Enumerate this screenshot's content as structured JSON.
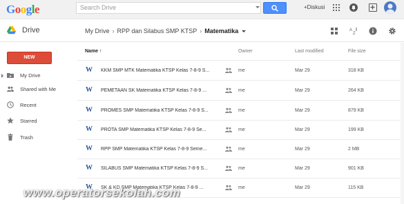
{
  "topbar": {
    "logo": [
      "G",
      "o",
      "o",
      "g",
      "l",
      "e"
    ],
    "logo_colors": [
      "#4285f4",
      "#ea4335",
      "#fbbc05",
      "#4285f4",
      "#34a853",
      "#ea4335"
    ],
    "search_placeholder": "Search Drive",
    "diskusi_label": "+Diskusi"
  },
  "drive": {
    "title": "Drive",
    "breadcrumb": [
      "My Drive",
      "RPP dan Silabus SMP KTSP",
      "Matematika"
    ]
  },
  "sidebar": {
    "new_label": "NEW",
    "items": [
      {
        "label": "My Drive",
        "icon": "folder-icon"
      },
      {
        "label": "Shared with Me",
        "icon": "people-icon"
      },
      {
        "label": "Recent",
        "icon": "clock-icon"
      },
      {
        "label": "Starred",
        "icon": "star-icon"
      },
      {
        "label": "Trash",
        "icon": "trash-icon"
      }
    ]
  },
  "list": {
    "headers": {
      "name": "Name ↑",
      "owner": "Owner",
      "modified": "Last modified",
      "size": "File size"
    },
    "files": [
      {
        "icon": "W",
        "name": "KKM SMP MTK Matematika KTSP Kelas 7-8-9 S...",
        "owner": "me",
        "modified": "Mar 29",
        "size": "318 KB"
      },
      {
        "icon": "W",
        "name": "PEMETAAN SK Matematika KTSP Kelas 7-8-9 ...",
        "owner": "me",
        "modified": "Mar 29",
        "size": "264 KB"
      },
      {
        "icon": "W",
        "name": "PROMES SMP Matematika KTSP Kelas 7-8-9 S...",
        "owner": "me",
        "modified": "Mar 29",
        "size": "879 KB"
      },
      {
        "icon": "W",
        "name": "PROTA SMP Matematika KTSP Kelas 7-8-9 Se...",
        "owner": "me",
        "modified": "Mar 29",
        "size": "199 KB"
      },
      {
        "icon": "W",
        "name": "RPP SMP Matematika KTSP Kelas 7-8-9 Seme...",
        "owner": "me",
        "modified": "Mar 29",
        "size": "2 MB"
      },
      {
        "icon": "W",
        "name": "SILABUS SMP Matematika KTSP Kelas 7-8-9 S...",
        "owner": "me",
        "modified": "Mar 29",
        "size": "901 KB"
      },
      {
        "icon": "W",
        "name": "SK & KD SMP Matematika KTSP Kelas 7-8-9 ...",
        "owner": "me",
        "modified": "Mar 29",
        "size": "115 KB"
      }
    ]
  },
  "watermark": "www.operatorsekolah.com"
}
